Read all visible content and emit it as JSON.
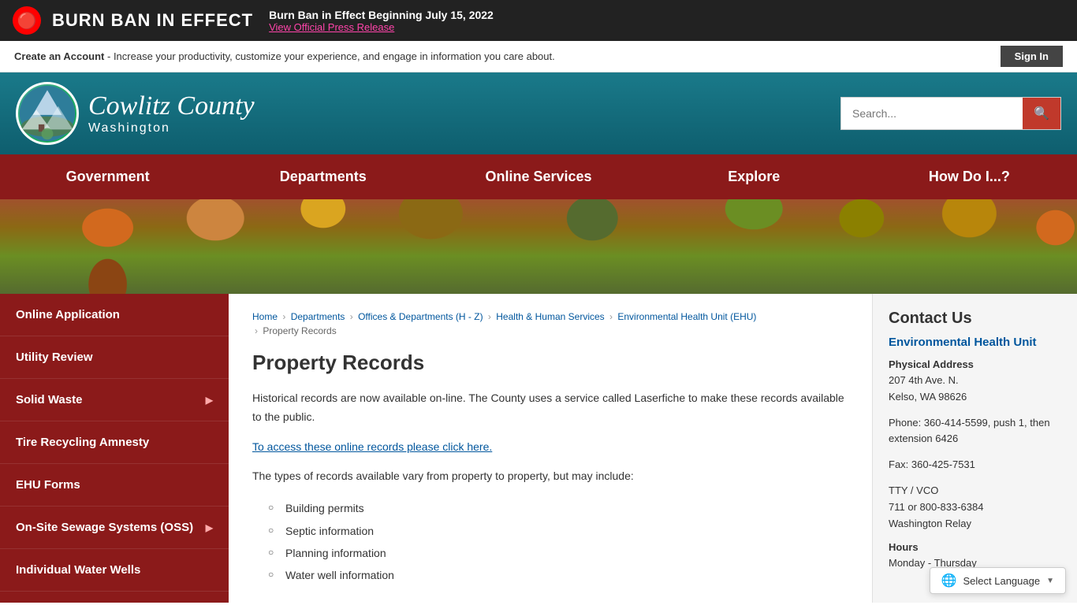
{
  "burn_ban": {
    "icon": "🔴",
    "title": "BURN BAN IN EFFECT",
    "date_line": "Burn Ban in Effect Beginning July 15, 2022",
    "link_text": "View Official Press Release"
  },
  "account_bar": {
    "create_prefix": "Create an Account",
    "create_suffix": " - Increase your productivity, customize your experience, and engage in information you care about.",
    "sign_in_label": "Sign In"
  },
  "header": {
    "site_name": "Cowlitz County",
    "state": "Washington",
    "search_placeholder": "Search..."
  },
  "nav": {
    "items": [
      {
        "label": "Government"
      },
      {
        "label": "Departments"
      },
      {
        "label": "Online Services"
      },
      {
        "label": "Explore"
      },
      {
        "label": "How Do I...?"
      }
    ]
  },
  "sidebar": {
    "items": [
      {
        "label": "Online Application",
        "has_arrow": false
      },
      {
        "label": "Utility Review",
        "has_arrow": false
      },
      {
        "label": "Solid Waste",
        "has_arrow": true
      },
      {
        "label": "Tire Recycling Amnesty",
        "has_arrow": false
      },
      {
        "label": "EHU Forms",
        "has_arrow": false
      },
      {
        "label": "On-Site Sewage Systems (OSS)",
        "has_arrow": true
      },
      {
        "label": "Individual Water Wells",
        "has_arrow": false
      }
    ]
  },
  "breadcrumb": {
    "links": [
      "Home",
      "Departments",
      "Offices & Departments (H - Z)",
      "Health & Human Services",
      "Environmental Health Unit (EHU)"
    ],
    "current": "Property Records"
  },
  "main_content": {
    "page_title": "Property Records",
    "para1": "Historical records are now available on-line. The County uses a service called Laserfiche to make these records available to the public.",
    "link_text": "To access these online records please click here.",
    "para2": "The types of records available vary from property to property, but may include:",
    "list_items": [
      "Building permits",
      "Septic information",
      "Planning information",
      "Water well information"
    ]
  },
  "contact": {
    "section_title": "Contact Us",
    "department": "Environmental Health Unit",
    "address_label": "Physical Address",
    "address_line1": "207 4th Ave. N.",
    "address_line2": "Kelso, WA 98626",
    "phone_label": "Phone:",
    "phone": "360-414-5599, push 1, then extension 6426",
    "fax_label": "Fax:",
    "fax": "360-425-7531",
    "tty_label": "TTY / VCO",
    "tty": "711 or 800-833-6384",
    "tty_relay": "Washington Relay",
    "hours_label": "Hours",
    "hours_placeholder": "Monday - Thursday"
  },
  "language_selector": {
    "label": "Select Language",
    "globe_icon": "🌐"
  }
}
